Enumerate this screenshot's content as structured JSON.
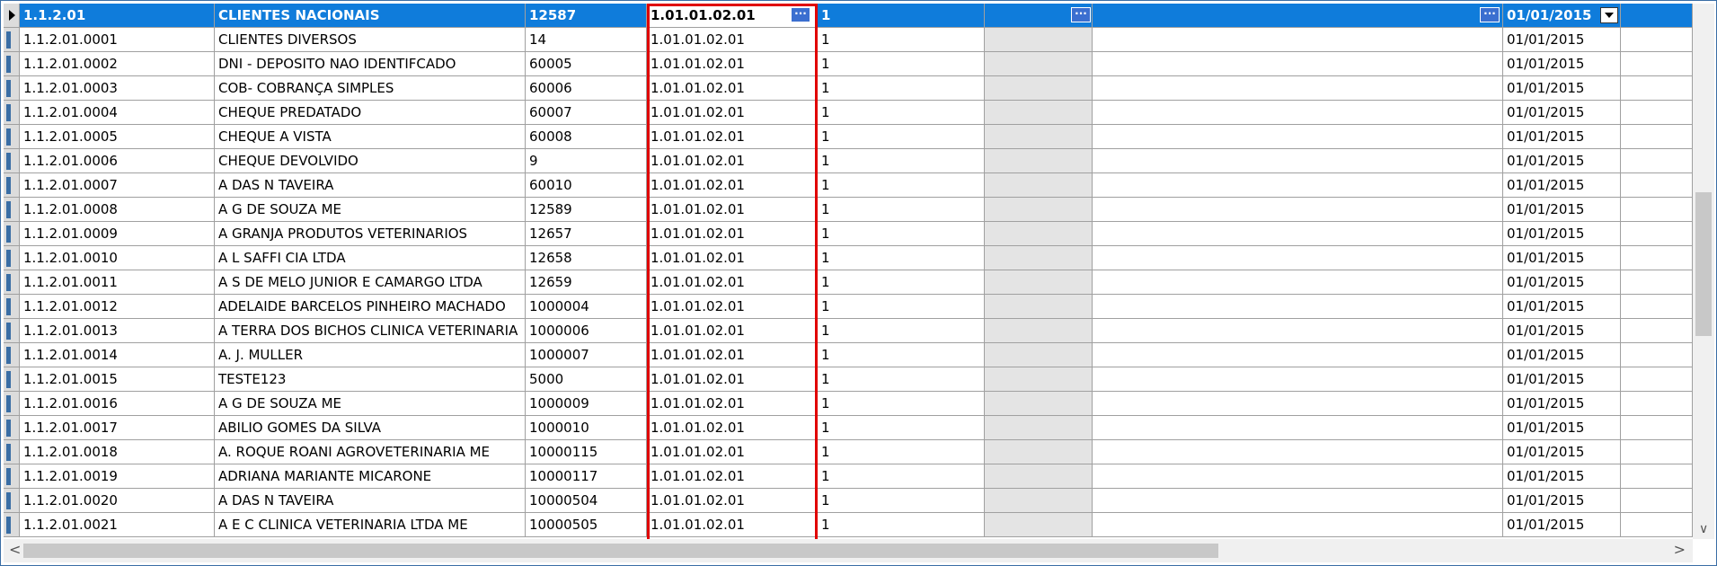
{
  "selected_row": {
    "code": "1.1.2.01",
    "name": "CLIENTES NACIONAIS",
    "number": "12587",
    "account": "1.01.01.02.01",
    "one": "1",
    "date": "01/01/2015"
  },
  "rows": [
    {
      "code": "1.1.2.01.0001",
      "name": "CLIENTES DIVERSOS",
      "number": "14",
      "account": "1.01.01.02.01",
      "one": "1",
      "date": "01/01/2015"
    },
    {
      "code": "1.1.2.01.0002",
      "name": "DNI - DEPOSITO NAO IDENTIFCADO",
      "number": "60005",
      "account": "1.01.01.02.01",
      "one": "1",
      "date": "01/01/2015"
    },
    {
      "code": "1.1.2.01.0003",
      "name": "COB- COBRANÇA SIMPLES",
      "number": "60006",
      "account": "1.01.01.02.01",
      "one": "1",
      "date": "01/01/2015"
    },
    {
      "code": "1.1.2.01.0004",
      "name": "CHEQUE PREDATADO",
      "number": "60007",
      "account": "1.01.01.02.01",
      "one": "1",
      "date": "01/01/2015"
    },
    {
      "code": "1.1.2.01.0005",
      "name": "CHEQUE A VISTA",
      "number": "60008",
      "account": "1.01.01.02.01",
      "one": "1",
      "date": "01/01/2015"
    },
    {
      "code": "1.1.2.01.0006",
      "name": "CHEQUE DEVOLVIDO",
      "number": "9",
      "account": "1.01.01.02.01",
      "one": "1",
      "date": "01/01/2015"
    },
    {
      "code": "1.1.2.01.0007",
      "name": "A DAS N TAVEIRA",
      "number": "60010",
      "account": "1.01.01.02.01",
      "one": "1",
      "date": "01/01/2015"
    },
    {
      "code": "1.1.2.01.0008",
      "name": "A G DE SOUZA ME",
      "number": "12589",
      "account": "1.01.01.02.01",
      "one": "1",
      "date": "01/01/2015"
    },
    {
      "code": "1.1.2.01.0009",
      "name": "A GRANJA PRODUTOS VETERINARIOS",
      "number": "12657",
      "account": "1.01.01.02.01",
      "one": "1",
      "date": "01/01/2015"
    },
    {
      "code": "1.1.2.01.0010",
      "name": "A L SAFFI CIA LTDA",
      "number": "12658",
      "account": "1.01.01.02.01",
      "one": "1",
      "date": "01/01/2015"
    },
    {
      "code": "1.1.2.01.0011",
      "name": "A S DE MELO JUNIOR E CAMARGO LTDA",
      "number": "12659",
      "account": "1.01.01.02.01",
      "one": "1",
      "date": "01/01/2015"
    },
    {
      "code": "1.1.2.01.0012",
      "name": "ADELAIDE BARCELOS PINHEIRO MACHADO",
      "number": "1000004",
      "account": "1.01.01.02.01",
      "one": "1",
      "date": "01/01/2015"
    },
    {
      "code": "1.1.2.01.0013",
      "name": "A TERRA DOS BICHOS CLINICA VETERINARIA",
      "number": "1000006",
      "account": "1.01.01.02.01",
      "one": "1",
      "date": "01/01/2015"
    },
    {
      "code": "1.1.2.01.0014",
      "name": "A. J. MULLER",
      "number": "1000007",
      "account": "1.01.01.02.01",
      "one": "1",
      "date": "01/01/2015"
    },
    {
      "code": "1.1.2.01.0015",
      "name": "TESTE123",
      "number": "5000",
      "account": "1.01.01.02.01",
      "one": "1",
      "date": "01/01/2015"
    },
    {
      "code": "1.1.2.01.0016",
      "name": "A G DE SOUZA ME",
      "number": "1000009",
      "account": "1.01.01.02.01",
      "one": "1",
      "date": "01/01/2015"
    },
    {
      "code": "1.1.2.01.0017",
      "name": "ABILIO GOMES DA SILVA",
      "number": "1000010",
      "account": "1.01.01.02.01",
      "one": "1",
      "date": "01/01/2015"
    },
    {
      "code": "1.1.2.01.0018",
      "name": "A. ROQUE ROANI AGROVETERINARIA ME",
      "number": "10000115",
      "account": "1.01.01.02.01",
      "one": "1",
      "date": "01/01/2015"
    },
    {
      "code": "1.1.2.01.0019",
      "name": "ADRIANA MARIANTE MICARONE",
      "number": "10000117",
      "account": "1.01.01.02.01",
      "one": "1",
      "date": "01/01/2015"
    },
    {
      "code": "1.1.2.01.0020",
      "name": "A DAS N TAVEIRA",
      "number": "10000504",
      "account": "1.01.01.02.01",
      "one": "1",
      "date": "01/01/2015"
    },
    {
      "code": "1.1.2.01.0021",
      "name": "A E C CLINICA VETERINARIA LTDA ME",
      "number": "10000505",
      "account": "1.01.01.02.01",
      "one": "1",
      "date": "01/01/2015"
    }
  ],
  "colors": {
    "selection": "#0f7cdb",
    "highlight_border": "#e00000",
    "grid_line": "#a0a0a0"
  },
  "icons": {
    "ellipsis": "ellipsis-button-icon",
    "dropdown": "dropdown-arrow-icon",
    "row_pointer": "row-pointer-icon",
    "scroll_left": "scroll-left-arrow-icon",
    "scroll_right": "scroll-right-arrow-icon",
    "scroll_down": "scroll-down-arrow-icon"
  }
}
